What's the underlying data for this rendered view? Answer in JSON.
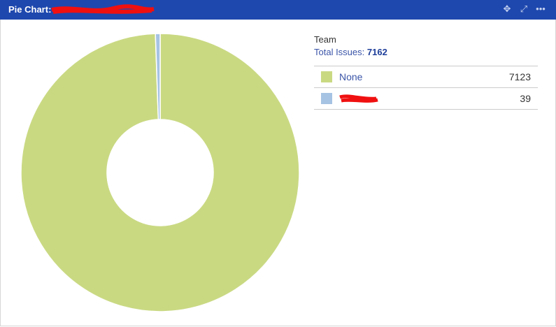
{
  "header": {
    "title": "Pie Chart:",
    "icons": [
      "move-icon",
      "expand-icon",
      "more-icon"
    ]
  },
  "legend": {
    "title": "Team",
    "total_label": "Total Issues:",
    "total": "7162"
  },
  "chart_data": {
    "type": "pie",
    "donut": true,
    "title": "Team",
    "slices": [
      {
        "label": "None",
        "value": 7123,
        "color": "#c9d982"
      },
      {
        "label": "",
        "value": 39,
        "color": "#a6c3e3"
      }
    ]
  }
}
